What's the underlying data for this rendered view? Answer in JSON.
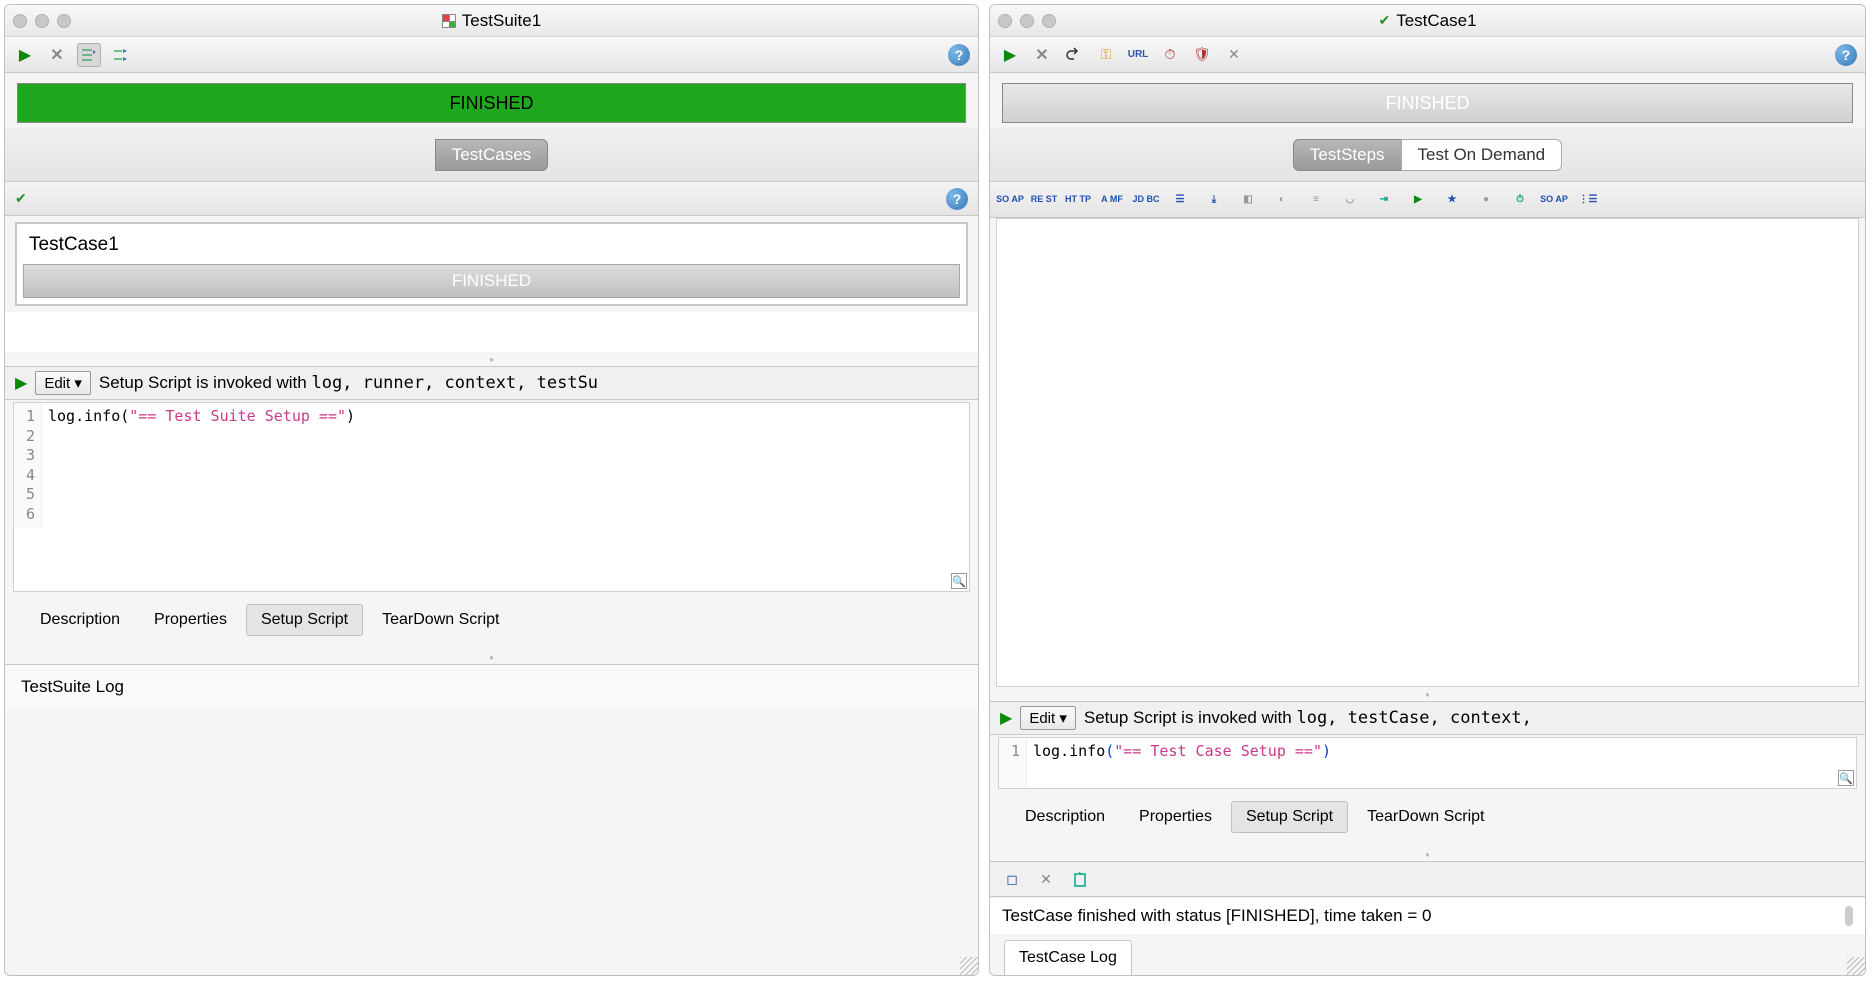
{
  "left": {
    "title": "TestSuite1",
    "status": "FINISHED",
    "tab": "TestCases",
    "testcase": {
      "name": "TestCase1",
      "status": "FINISHED"
    },
    "edit_label": "Edit ▾",
    "script_desc_pre": "Setup Script is invoked with ",
    "script_desc_vars": "log, runner, context, testSu",
    "code_plain": "log.info",
    "code_paren_open": "(",
    "code_string": "\"== Test Suite Setup ==\"",
    "code_paren_close": ")",
    "gutter": [
      "1",
      "2",
      "3",
      "4",
      "5",
      "6"
    ],
    "tabs": [
      "Description",
      "Properties",
      "Setup Script",
      "TearDown Script"
    ],
    "log_label": "TestSuite Log"
  },
  "right": {
    "title": "TestCase1",
    "status": "FINISHED",
    "maintabs": [
      "TestSteps",
      "Test On Demand"
    ],
    "step_btns": [
      "SO\nAP",
      "RE\nST",
      "HT\nTP",
      "A\nMF",
      "JD\nBC"
    ],
    "edit_label": "Edit ▾",
    "script_desc_pre": "Setup Script is invoked with ",
    "script_desc_vars": "log, testCase, context,",
    "code_plain": "log.info",
    "code_string": "\"== Test Case Setup ==\"",
    "gutter1": "1",
    "tabs": [
      "Description",
      "Properties",
      "Setup Script",
      "TearDown Script"
    ],
    "log_msg": "TestCase finished with status [FINISHED], time taken = 0",
    "log_label": "TestCase Log"
  },
  "help": "?"
}
